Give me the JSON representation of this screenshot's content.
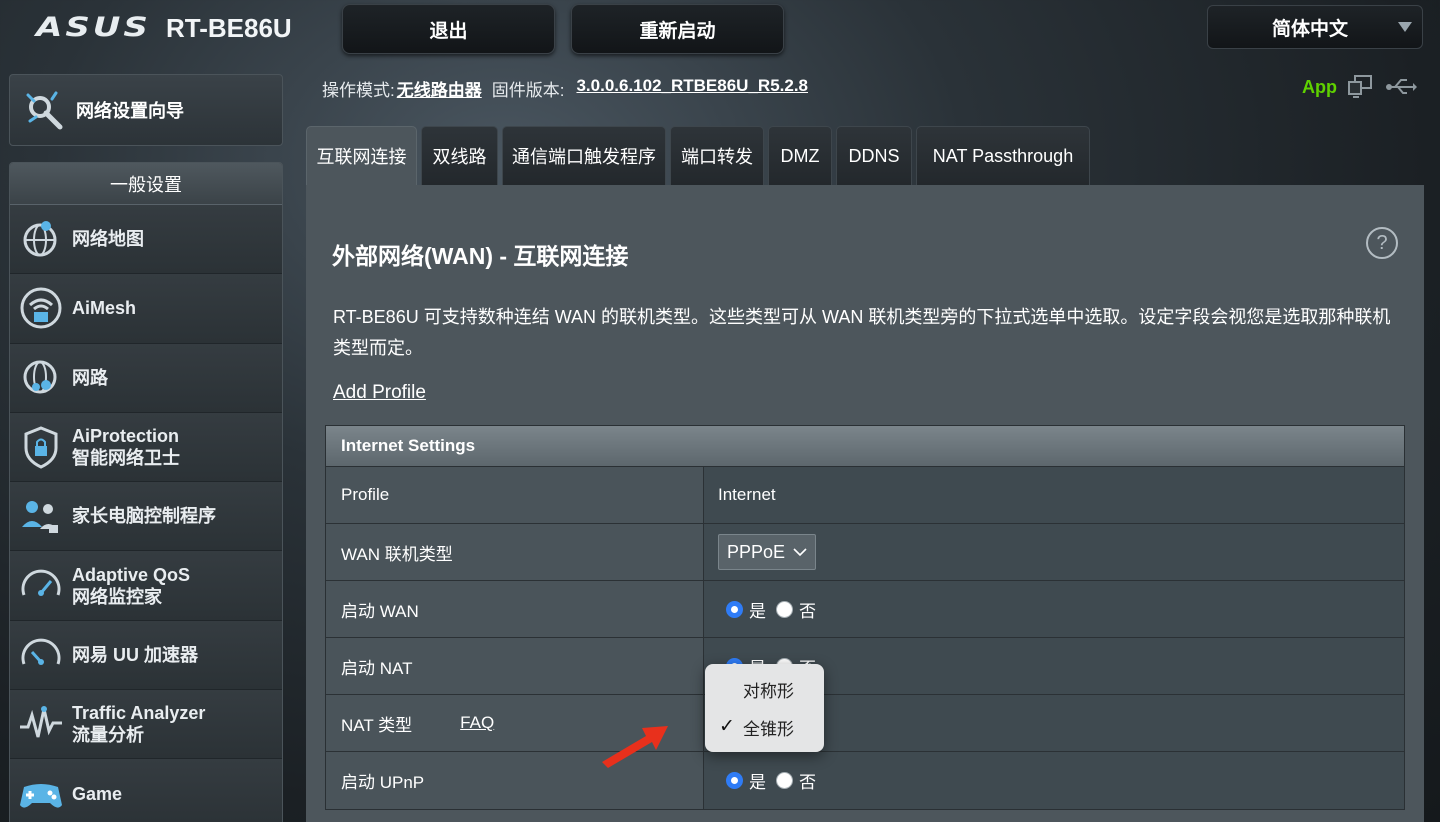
{
  "header": {
    "brand": "ASUS",
    "model": "RT-BE86U",
    "logout_label": "退出",
    "reboot_label": "重新启动",
    "language": "简体中文"
  },
  "sidebar": {
    "quick_setup": "网络设置向导",
    "section_title": "一般设置",
    "items": [
      {
        "label": "网络地图",
        "sub": "",
        "icon": "globe-network-icon"
      },
      {
        "label": "AiMesh",
        "sub": "",
        "icon": "aimesh-icon"
      },
      {
        "label": "网路",
        "sub": "",
        "icon": "guest-network-icon"
      },
      {
        "label": "AiProtection",
        "sub": "智能网络卫士",
        "icon": "shield-lock-icon"
      },
      {
        "label": "家长电脑控制程序",
        "sub": "",
        "icon": "parental-control-icon"
      },
      {
        "label": "Adaptive QoS",
        "sub": "网络监控家",
        "icon": "speedometer-icon"
      },
      {
        "label": "网易 UU 加速器",
        "sub": "",
        "icon": "speedometer-icon"
      },
      {
        "label": "Traffic Analyzer",
        "sub": "流量分析",
        "icon": "traffic-wave-icon"
      },
      {
        "label": "Game",
        "sub": "",
        "icon": "gamepad-icon"
      }
    ]
  },
  "info": {
    "mode_label": "操作模式:",
    "mode_value": "无线路由器",
    "fw_label": "固件版本:",
    "fw_value": "3.0.0.6.102_RTBE86U_R5.2.8",
    "app_label": "App"
  },
  "tabs": [
    "互联网连接",
    "双线路",
    "通信端口触发程序",
    "端口转发",
    "DMZ",
    "DDNS",
    "NAT Passthrough"
  ],
  "main": {
    "title": "外部网络(WAN) - 互联网连接",
    "help": "?",
    "description": "RT-BE86U 可支持数种连结 WAN 的联机类型。这些类型可从 WAN 联机类型旁的下拉式选单中选取。设定字段会视您是选取那种联机类型而定。",
    "add_profile": "Add Profile"
  },
  "settings": {
    "header": "Internet Settings",
    "profile_label": "Profile",
    "profile_value": "Internet",
    "wan_type_label": "WAN 联机类型",
    "wan_type_value": "PPPoE",
    "enable_wan_label": "启动 WAN",
    "enable_nat_label": "启动 NAT",
    "nat_type_label": "NAT 类型",
    "faq_label": "FAQ",
    "upnp_label": "启动 UPnP",
    "yes": "是",
    "no": "否"
  },
  "nat_popup": {
    "options": [
      "对称形",
      "全锥形"
    ],
    "selected": "全锥形"
  },
  "colors": {
    "accent_radio": "#2f7cf6",
    "app_green": "#5fd100",
    "annotation_arrow": "#e8301c"
  }
}
